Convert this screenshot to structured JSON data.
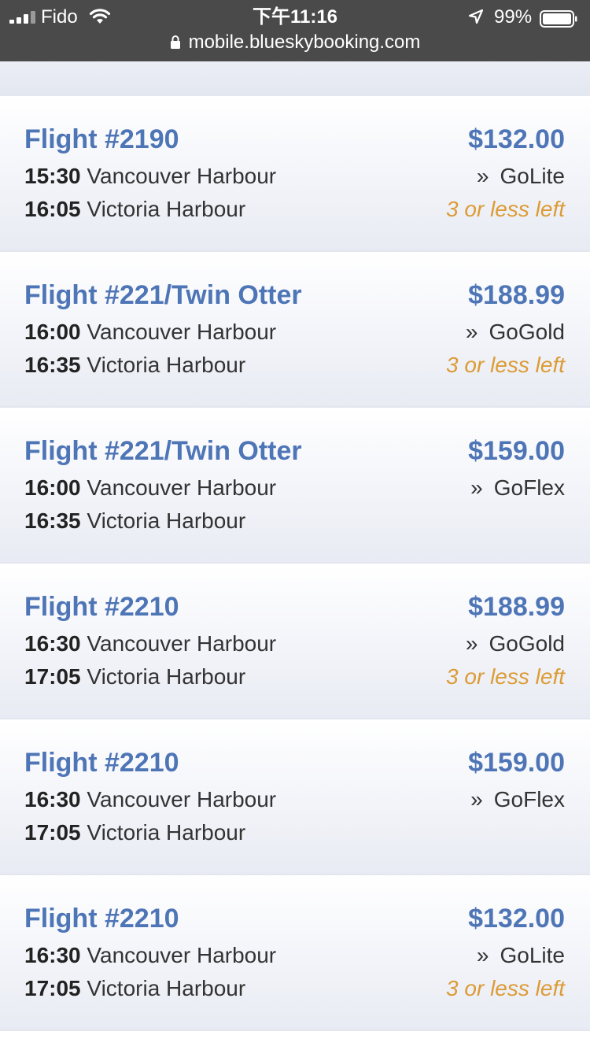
{
  "status_bar": {
    "carrier": "Fido",
    "time": "下午11:16",
    "battery": "99%",
    "url": "mobile.blueskybooking.com"
  },
  "colors": {
    "status_bar_bg": "#4a4a4a",
    "flight_title": "#4e75b6",
    "availability": "#dc9b35",
    "text": "#333333"
  },
  "flights": [
    {
      "name": "Flight #2190",
      "price": "$132.00",
      "dep_time": "15:30",
      "dep_place": "Vancouver Harbour",
      "arr_time": "16:05",
      "arr_place": "Victoria Harbour",
      "fare_marker": "»",
      "fare": "GoLite",
      "availability": "3 or less left"
    },
    {
      "name": "Flight #221/Twin Otter",
      "price": "$188.99",
      "dep_time": "16:00",
      "dep_place": "Vancouver Harbour",
      "arr_time": "16:35",
      "arr_place": "Victoria Harbour",
      "fare_marker": "»",
      "fare": "GoGold",
      "availability": "3 or less left"
    },
    {
      "name": "Flight #221/Twin Otter",
      "price": "$159.00",
      "dep_time": "16:00",
      "dep_place": "Vancouver Harbour",
      "arr_time": "16:35",
      "arr_place": "Victoria Harbour",
      "fare_marker": "»",
      "fare": "GoFlex",
      "availability": ""
    },
    {
      "name": "Flight #2210",
      "price": "$188.99",
      "dep_time": "16:30",
      "dep_place": "Vancouver Harbour",
      "arr_time": "17:05",
      "arr_place": "Victoria Harbour",
      "fare_marker": "»",
      "fare": "GoGold",
      "availability": "3 or less left"
    },
    {
      "name": "Flight #2210",
      "price": "$159.00",
      "dep_time": "16:30",
      "dep_place": "Vancouver Harbour",
      "arr_time": "17:05",
      "arr_place": "Victoria Harbour",
      "fare_marker": "»",
      "fare": "GoFlex",
      "availability": ""
    },
    {
      "name": "Flight #2210",
      "price": "$132.00",
      "dep_time": "16:30",
      "dep_place": "Vancouver Harbour",
      "arr_time": "17:05",
      "arr_place": "Victoria Harbour",
      "fare_marker": "»",
      "fare": "GoLite",
      "availability": "3 or less left"
    }
  ]
}
